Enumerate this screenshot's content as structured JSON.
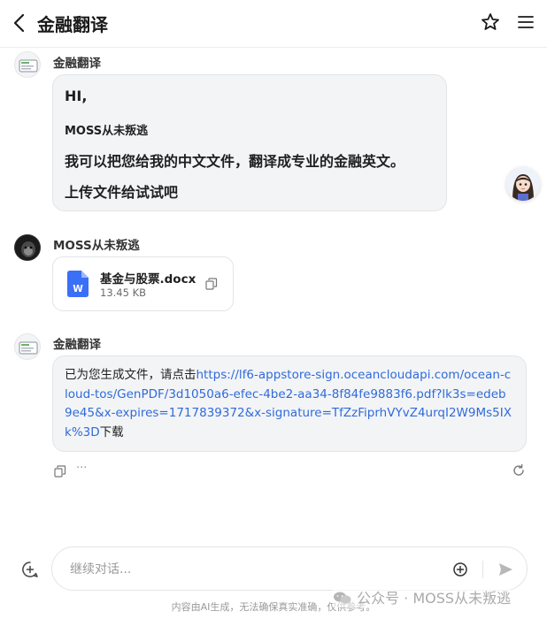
{
  "header": {
    "title": "金融翻译"
  },
  "messages": {
    "m1": {
      "sender": "金融翻译",
      "lines": [
        "HI,",
        "MOSS从未叛逃",
        "我可以把您给我的中文文件，翻译成专业的金融英文。",
        "上传文件给试试吧"
      ]
    },
    "m2": {
      "sender": "MOSS从未叛逃",
      "file": {
        "name": "基金与股票.docx",
        "size": "13.45 KB",
        "icon_letter": "W"
      }
    },
    "m3": {
      "sender": "金融翻译",
      "text_before": "已为您生成文件，请点击",
      "link": "https://lf6-appstore-sign.oceancloudapi.com/ocean-cloud-tos/GenPDF/3d1050a6-efec-4be2-aa34-8f84fe9883f6.pdf?lk3s=edeb9e45&x-expires=1717839372&x-signature=TfZzFiprhVYvZ4urqI2W9Ms5IXk%3D",
      "text_after": "下载",
      "more": "···"
    }
  },
  "input": {
    "placeholder": "继续对话..."
  },
  "footer": {
    "disclaimer": "内容由AI生成，无法确保真实准确，仅供参考。"
  },
  "watermark": {
    "text": "公众号 · MOSS从未叛逃"
  },
  "colors": {
    "link": "#2f6bdb",
    "bubble": "#f3f4f6",
    "doc_icon": "#3a6ff7"
  },
  "icons": [
    "back-arrow-icon",
    "star-icon",
    "menu-icon",
    "copy-icon",
    "more-icon",
    "refresh-icon",
    "new-chat-icon",
    "add-circle-icon",
    "send-icon",
    "wechat-icon",
    "word-doc-icon"
  ]
}
